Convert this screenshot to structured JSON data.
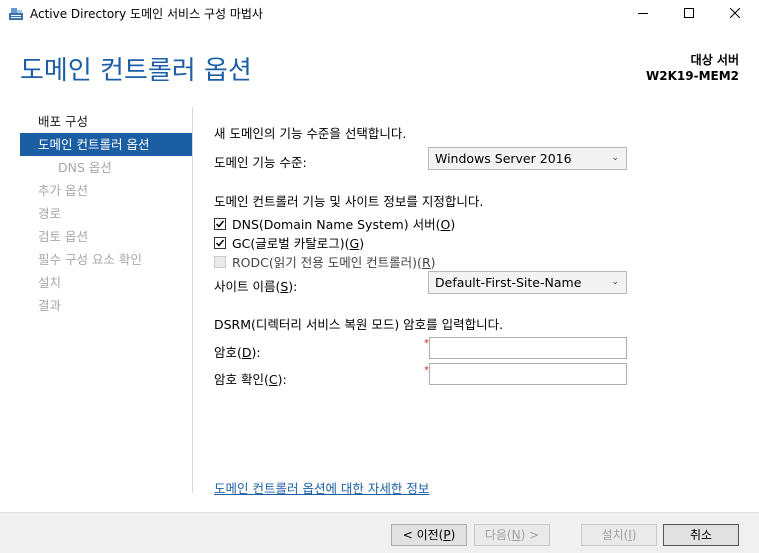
{
  "window": {
    "title": "Active Directory 도메인 서비스 구성 마법사"
  },
  "header": {
    "title": "도메인 컨트롤러 옵션",
    "target_label": "대상 서버",
    "target_server": "W2K19-MEM2"
  },
  "nav": {
    "items": [
      {
        "label": "배포 구성",
        "state": "normal"
      },
      {
        "label": "도메인 컨트롤러 옵션",
        "state": "active"
      },
      {
        "label": "DNS 옵션",
        "state": "disabled-sub"
      },
      {
        "label": "추가 옵션",
        "state": "disabled"
      },
      {
        "label": "경로",
        "state": "disabled"
      },
      {
        "label": "검토 옵션",
        "state": "disabled"
      },
      {
        "label": "필수 구성 요소 확인",
        "state": "disabled"
      },
      {
        "label": "설치",
        "state": "disabled"
      },
      {
        "label": "결과",
        "state": "disabled"
      }
    ]
  },
  "main": {
    "functional_level_heading": "새 도메인의 기능 수준을 선택합니다.",
    "domain_level_label": "도메인 기능 수준:",
    "domain_level_value": "Windows Server 2016",
    "capabilities_heading": "도메인 컨트롤러 기능 및 사이트 정보를 지정합니다.",
    "dns_label_prefix": "DNS(Domain Name System) 서버(",
    "dns_accel": "O",
    "dns_label_suffix": ")",
    "gc_label_prefix": "GC(글로벌 카탈로그)(",
    "gc_accel": "G",
    "gc_label_suffix": ")",
    "rodc_label_prefix": "RODC(읽기 전용 도메인 컨트롤러)(",
    "rodc_accel": "R",
    "rodc_label_suffix": ")",
    "site_label_prefix": "사이트 이름(",
    "site_accel": "S",
    "site_label_suffix": "):",
    "site_value": "Default-First-Site-Name",
    "dsrm_heading": "DSRM(디렉터리 서비스 복원 모드) 암호를 입력합니다.",
    "password_label_prefix": "암호(",
    "password_accel": "D",
    "password_label_suffix": "):",
    "confirm_label_prefix": "암호 확인(",
    "confirm_accel": "C",
    "confirm_label_suffix": "):",
    "required_mark": "*",
    "help_link": "도메인 컨트롤러 옵션에 대한 자세한 정보"
  },
  "footer": {
    "prev_prefix": "< 이전(",
    "prev_accel": "P",
    "prev_suffix": ")",
    "next_prefix": "다음(",
    "next_accel": "N",
    "next_suffix": ") >",
    "install_prefix": "설치(",
    "install_accel": "I",
    "install_suffix": ")",
    "cancel": "취소"
  },
  "colors": {
    "accent": "#1d5fa6",
    "nav_active_bg": "#1c5ea3",
    "required": "#e0261c"
  },
  "checkboxes": {
    "dns_checked": true,
    "gc_checked": true,
    "rodc_checked": false
  }
}
